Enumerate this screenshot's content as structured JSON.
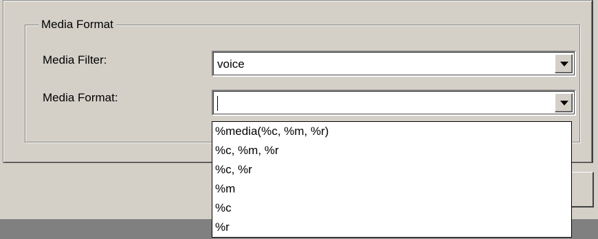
{
  "group": {
    "title": "Media Format"
  },
  "media_filter": {
    "label": "Media Filter:",
    "value": "voice"
  },
  "media_format": {
    "label": "Media Format:",
    "value": ""
  },
  "dropdown_options": [
    "%media(%c, %m, %r)",
    "%c, %m, %r",
    "%c, %r",
    "%m",
    "%c",
    "%r"
  ]
}
